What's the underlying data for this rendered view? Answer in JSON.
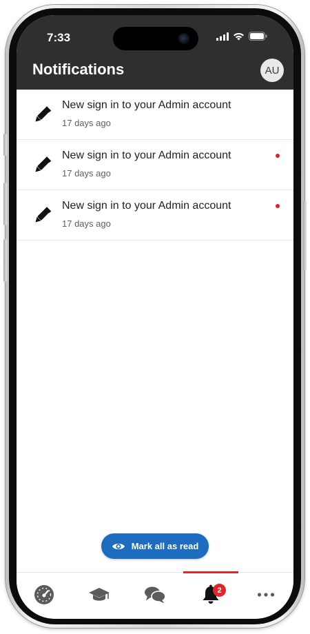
{
  "status_bar": {
    "time": "7:33"
  },
  "header": {
    "title": "Notifications",
    "avatar_initials": "AU"
  },
  "notifications": [
    {
      "title": "New sign in to your Admin account",
      "time": "17 days ago",
      "unread": false,
      "icon": "pen-icon"
    },
    {
      "title": "New sign in to your Admin account",
      "time": "17 days ago",
      "unread": true,
      "icon": "pen-icon"
    },
    {
      "title": "New sign in to your Admin account",
      "time": "17 days ago",
      "unread": true,
      "icon": "pen-icon"
    }
  ],
  "actions": {
    "mark_all_label": "Mark all as read"
  },
  "tab_bar": {
    "active_tab": "notifications",
    "notification_badge": "2",
    "tabs": [
      {
        "id": "dashboard",
        "icon": "speedometer-icon"
      },
      {
        "id": "courses",
        "icon": "graduation-cap-icon"
      },
      {
        "id": "messages",
        "icon": "chat-bubbles-icon"
      },
      {
        "id": "notifications",
        "icon": "bell-icon"
      },
      {
        "id": "more",
        "icon": "more-dots-icon"
      }
    ]
  },
  "colors": {
    "header_bg": "#2f2f31",
    "accent_blue": "#1d6cc0",
    "accent_red": "#e0262b"
  }
}
